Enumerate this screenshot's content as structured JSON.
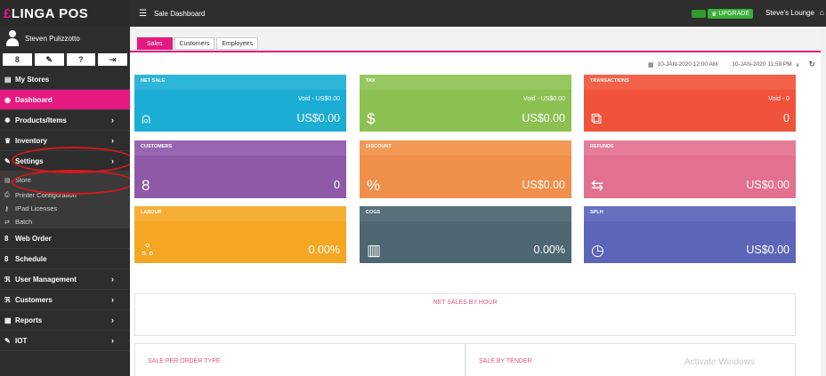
{
  "app": {
    "logo_main": "LINGA",
    "logo_sub": "POS",
    "page_title": "Sale Dashboard"
  },
  "topbar": {
    "upgrade_label": "UPGRADE",
    "store_name": "Steve's Lounge"
  },
  "user": {
    "name": "Steven Pulizzotto"
  },
  "sidebar": {
    "icons": [
      "user-icon",
      "wrench-icon",
      "help-icon",
      "logout-icon"
    ],
    "items": [
      {
        "label": "My Stores",
        "icon": "▤"
      },
      {
        "label": "Dashboard",
        "icon": "◉",
        "active": true
      },
      {
        "label": "Products/Items",
        "icon": "✹",
        "chevron": "›"
      },
      {
        "label": "Inventory",
        "icon": "♛",
        "chevron": "›"
      },
      {
        "label": "Settings",
        "icon": "✎",
        "chevron": "›"
      },
      {
        "label": "Web Order",
        "icon": "8"
      },
      {
        "label": "Schedule",
        "icon": "8"
      },
      {
        "label": "User Management",
        "icon": "ℜ",
        "chevron": "›"
      },
      {
        "label": "Customers",
        "icon": "ℜ",
        "chevron": "›"
      },
      {
        "label": "Reports",
        "icon": "▦",
        "chevron": "›"
      },
      {
        "label": "IOT",
        "icon": "✎",
        "chevron": "›"
      }
    ],
    "sub_items": [
      {
        "label": "Store",
        "icon": "▤"
      },
      {
        "label": "Printer Configuration",
        "icon": "⎙"
      },
      {
        "label": "IPad Licenses",
        "icon": "⚷"
      },
      {
        "label": "Batch",
        "icon": "⇄"
      }
    ]
  },
  "tabs": [
    {
      "label": "Sales",
      "active": true
    },
    {
      "label": "Customers"
    },
    {
      "label": "Employees"
    }
  ],
  "date_range": {
    "from": "10-JAN-2020 12:00 AM",
    "to": "10-JAN-2020 11:59 PM"
  },
  "colors": {
    "brand": "#e5197f",
    "net_sale": "#1badd3",
    "tax": "#8cc152",
    "transactions": "#f0533a",
    "customers": "#8e5aa8",
    "discount": "#f08f49",
    "refunds": "#e4708f",
    "labour": "#f5a623",
    "cogs": "#4d6670",
    "splh": "#5c65b8"
  },
  "cards": {
    "net_sale": {
      "title": "NET SALE",
      "void": "Void - US$0.00",
      "value": "US$0.00",
      "icon": "cloche-icon"
    },
    "tax": {
      "title": "TAX",
      "void": "Void - US$0.00",
      "value": "US$0.00",
      "icon": "money-bag-icon"
    },
    "transactions": {
      "title": "TRANSACTIONS",
      "void": "Void - 0",
      "value": "0",
      "icon": "cards-icon"
    },
    "customers": {
      "title": "CUSTOMERS",
      "value": "0",
      "icon": "person-icon"
    },
    "discount": {
      "title": "DISCOUNT",
      "value": "US$0.00",
      "icon": "discount-icon"
    },
    "refunds": {
      "title": "REFUNDS",
      "value": "US$0.00",
      "icon": "refund-icon"
    },
    "labour": {
      "title": "LABOUR",
      "value": "0.00%",
      "icon": "group-icon"
    },
    "cogs": {
      "title": "COGS",
      "value": "0.00%",
      "icon": "boxes-icon"
    },
    "splh": {
      "title": "SPLH",
      "value": "US$0.00",
      "icon": "clock-icon"
    }
  },
  "panels": {
    "net_sales_by_hour": "NET SALES BY HOUR",
    "sale_per_order_type": "SALE PER ORDER TYPE",
    "sale_by_tender": "SALE BY TENDER",
    "activate_windows": "Activate Windows"
  }
}
